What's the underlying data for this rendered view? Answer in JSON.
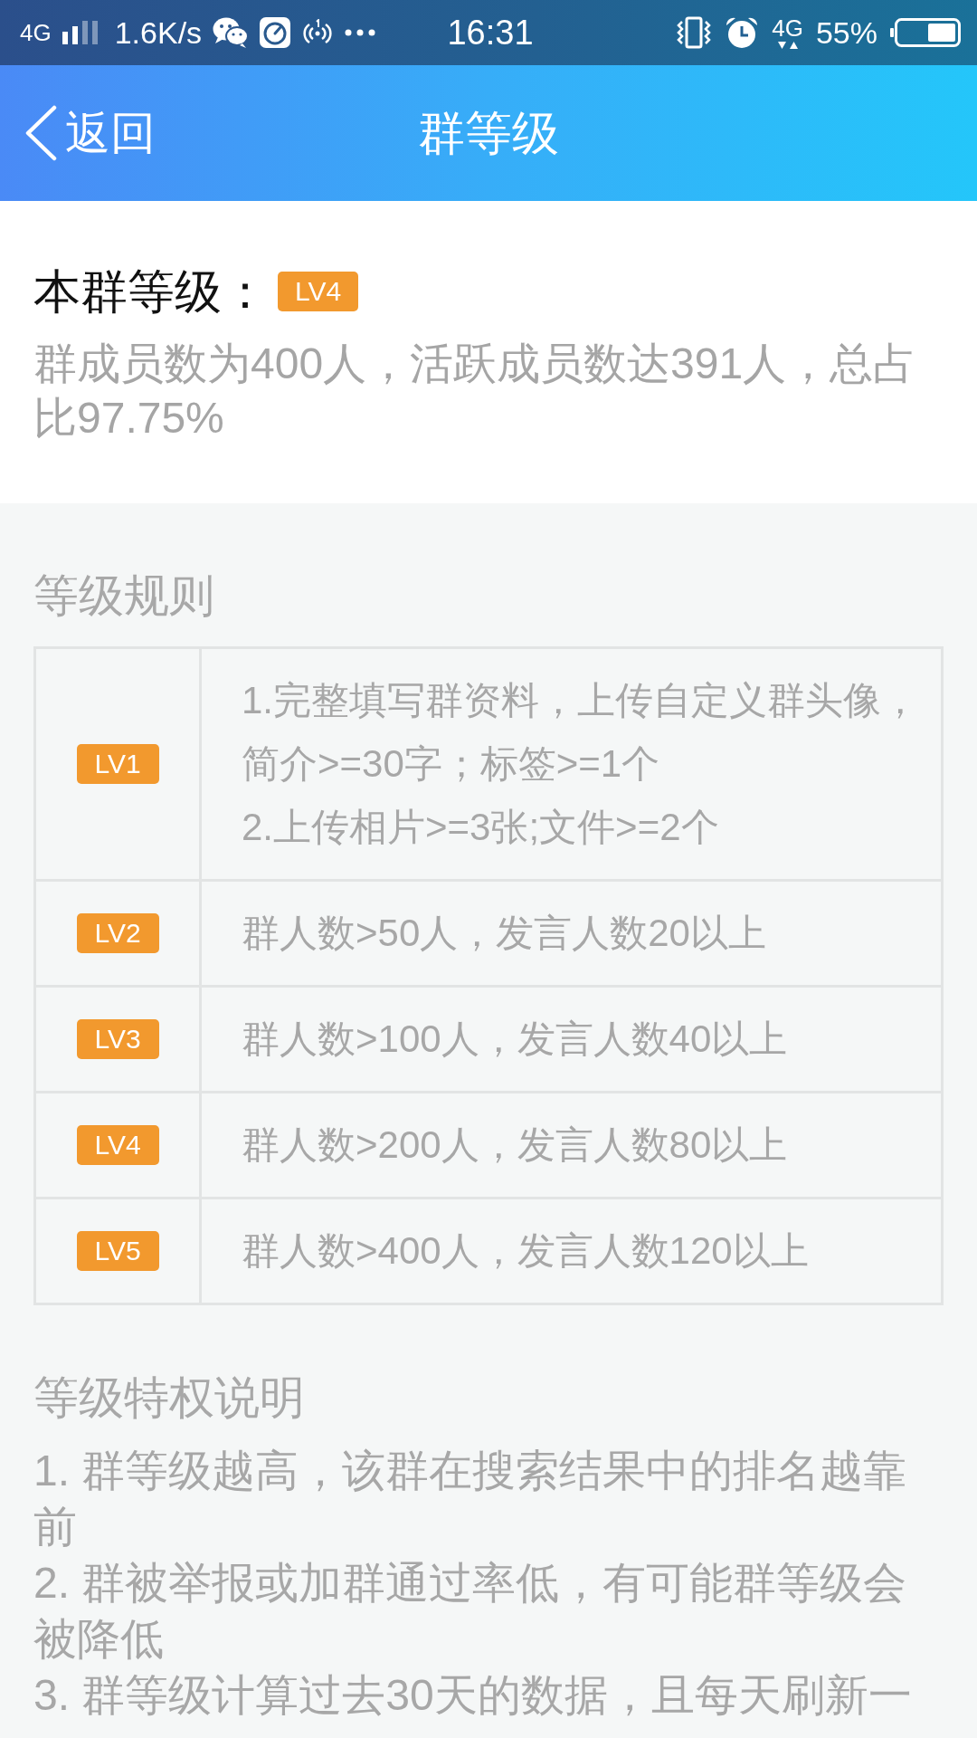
{
  "status_bar": {
    "network": "4G",
    "speed": "1.6K/s",
    "time": "16:31",
    "data_network": "4G",
    "battery": "55%"
  },
  "nav_bar": {
    "back": "返回",
    "title": "群等级"
  },
  "group_level": {
    "label": "本群等级：",
    "badge": "LV4",
    "summary": "群成员数为400人，活跃成员数达391人，总占比97.75%"
  },
  "rules": {
    "heading": "等级规则",
    "rows": [
      {
        "level": "LV1",
        "lines": [
          "1.完整填写群资料，上传自定义群头像，简介>=30字；标签>=1个",
          "2.上传相片>=3张;文件>=2个"
        ]
      },
      {
        "level": "LV2",
        "lines": [
          "群人数>50人，发言人数20以上"
        ]
      },
      {
        "level": "LV3",
        "lines": [
          "群人数>100人，发言人数40以上"
        ]
      },
      {
        "level": "LV4",
        "lines": [
          "群人数>200人，发言人数80以上"
        ]
      },
      {
        "level": "LV5",
        "lines": [
          "群人数>400人，发言人数120以上"
        ]
      }
    ]
  },
  "privileges": {
    "heading": "等级特权说明",
    "items": [
      "1. 群等级越高，该群在搜索结果中的排名越靠前",
      "2. 群被举报或加群通过率低，有可能群等级会被降低",
      "3. 群等级计算过去30天的数据，且每天刷新一"
    ]
  }
}
